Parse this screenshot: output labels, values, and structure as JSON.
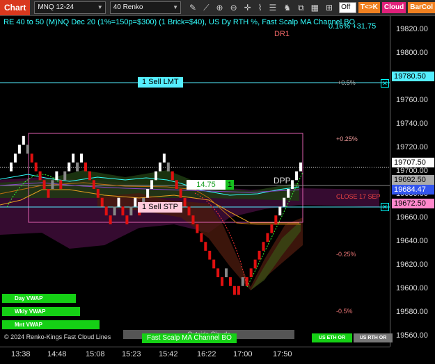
{
  "toolbar": {
    "chart_label": "Chart",
    "instrument": "MNQ 12-24",
    "bar_type": "40 Renko",
    "icons": [
      "pencil-icon",
      "draw-line-icon",
      "zoom-in-icon",
      "zoom-out-icon",
      "crosshair-icon",
      "indicators-icon",
      "list-icon",
      "strategy-icon",
      "copy-icon",
      "calendar-icon",
      "grid-icon"
    ],
    "off_value": "Off",
    "tk_label": "T<>K",
    "cloud_label": "Cloud",
    "barcol_label": "BarCol",
    "colors": {
      "chart_tab": "#d9381e",
      "tk": "#f08020",
      "cloud": "#e0207a",
      "barcol": "#f08020"
    }
  },
  "chart_data": {
    "type": "renko",
    "title": "RE 40 to 50 (M)NQ Dec 20 (1%=150p=$300) (1 Brick=$40), US Dy RTH %, Fast Scalp MA Channel BO",
    "title_suffix": "0.16% +31.75",
    "y_ticks": [
      19820,
      19800,
      19780,
      19760,
      19740,
      19720,
      19700,
      19680,
      19660,
      19640,
      19620,
      19600,
      19580,
      19560
    ],
    "y_tick_labels": [
      "19820.00",
      "19800.00",
      "19780.00",
      "19760.00",
      "19740.00",
      "19720.00",
      "19700.00",
      "19680.00",
      "19660.00",
      "19640.00",
      "19620.00",
      "19600.00",
      "19580.00",
      "19560.00"
    ],
    "ylim": [
      19551,
      19832
    ],
    "x_ticks": [
      "13:38",
      "14:48",
      "15:08",
      "15:23",
      "15:42",
      "16:22",
      "17:00",
      "17:50"
    ],
    "price_labels": [
      {
        "value": 19780.5,
        "text": "19780.50",
        "color": "#5ef"
      },
      {
        "value": 19707.5,
        "text": "19707.50",
        "color": "#ffffff"
      },
      {
        "value": 19692.5,
        "text": "19692.50",
        "color": "#aaa"
      },
      {
        "value": 19684.47,
        "text": "19684.47",
        "color": "#35e"
      },
      {
        "value": 19672.5,
        "text": "19672.50",
        "color": "#f8c"
      }
    ],
    "pct_levels": [
      {
        "text": "+0.5%",
        "value": 19780.5,
        "color": "#aaa"
      },
      {
        "text": "+0.25%",
        "value": 19731,
        "color": "#e99"
      },
      {
        "text": "-0.25%",
        "value": 19632,
        "color": "#e77"
      },
      {
        "text": "-0.5%",
        "value": 19583,
        "color": "#e77"
      }
    ],
    "dr1_label": "DR1",
    "dpp_label": "DPP",
    "close_label": "CLOSE 17 SEP",
    "bricks": [
      {
        "c": "w",
        "lo": 19700,
        "hi": 19707.5
      },
      {
        "c": "w",
        "lo": 19707.5,
        "hi": 19715
      },
      {
        "c": "w",
        "lo": 19715,
        "hi": 19722.5
      },
      {
        "c": "w",
        "lo": 19722.5,
        "hi": 19730
      },
      {
        "c": "g",
        "lo": 19715,
        "hi": 19722.5
      },
      {
        "c": "r",
        "lo": 19707.5,
        "hi": 19715
      },
      {
        "c": "r",
        "lo": 19700,
        "hi": 19707.5
      },
      {
        "c": "r",
        "lo": 19692.5,
        "hi": 19700
      },
      {
        "c": "r",
        "lo": 19685,
        "hi": 19692.5
      },
      {
        "c": "r",
        "lo": 19677.5,
        "hi": 19685
      },
      {
        "c": "g",
        "lo": 19685,
        "hi": 19692.5
      },
      {
        "c": "w",
        "lo": 19692.5,
        "hi": 19700
      },
      {
        "c": "r",
        "lo": 19685,
        "hi": 19692.5
      },
      {
        "c": "g",
        "lo": 19692.5,
        "hi": 19700
      },
      {
        "c": "w",
        "lo": 19700,
        "hi": 19707.5
      },
      {
        "c": "w",
        "lo": 19707.5,
        "hi": 19715
      },
      {
        "c": "g",
        "lo": 19700,
        "hi": 19707.5
      },
      {
        "c": "w",
        "lo": 19707.5,
        "hi": 19715
      },
      {
        "c": "r",
        "lo": 19700,
        "hi": 19707.5
      },
      {
        "c": "r",
        "lo": 19692.5,
        "hi": 19700
      },
      {
        "c": "r",
        "lo": 19685,
        "hi": 19692.5
      },
      {
        "c": "r",
        "lo": 19677.5,
        "hi": 19685
      },
      {
        "c": "r",
        "lo": 19670,
        "hi": 19677.5
      },
      {
        "c": "r",
        "lo": 19662.5,
        "hi": 19670
      },
      {
        "c": "r",
        "lo": 19655,
        "hi": 19662.5
      },
      {
        "c": "g",
        "lo": 19662.5,
        "hi": 19670
      },
      {
        "c": "w",
        "lo": 19670,
        "hi": 19677.5
      },
      {
        "c": "r",
        "lo": 19662.5,
        "hi": 19670
      },
      {
        "c": "r",
        "lo": 19655,
        "hi": 19662.5
      },
      {
        "c": "g",
        "lo": 19662.5,
        "hi": 19670
      },
      {
        "c": "w",
        "lo": 19670,
        "hi": 19677.5
      },
      {
        "c": "r",
        "lo": 19662.5,
        "hi": 19670
      },
      {
        "c": "g",
        "lo": 19670,
        "hi": 19677.5
      },
      {
        "c": "w",
        "lo": 19677.5,
        "hi": 19685
      },
      {
        "c": "w",
        "lo": 19685,
        "hi": 19692.5
      },
      {
        "c": "w",
        "lo": 19692.5,
        "hi": 19700
      },
      {
        "c": "w",
        "lo": 19700,
        "hi": 19707.5
      },
      {
        "c": "w",
        "lo": 19707.5,
        "hi": 19715
      },
      {
        "c": "g",
        "lo": 19700,
        "hi": 19707.5
      },
      {
        "c": "r",
        "lo": 19692.5,
        "hi": 19700
      },
      {
        "c": "r",
        "lo": 19685,
        "hi": 19692.5
      },
      {
        "c": "r",
        "lo": 19677.5,
        "hi": 19685
      },
      {
        "c": "r",
        "lo": 19670,
        "hi": 19677.5
      },
      {
        "c": "r",
        "lo": 19662.5,
        "hi": 19670
      },
      {
        "c": "r",
        "lo": 19655,
        "hi": 19662.5
      },
      {
        "c": "r",
        "lo": 19647.5,
        "hi": 19655
      },
      {
        "c": "r",
        "lo": 19640,
        "hi": 19647.5
      },
      {
        "c": "r",
        "lo": 19632.5,
        "hi": 19640
      },
      {
        "c": "r",
        "lo": 19625,
        "hi": 19632.5
      },
      {
        "c": "r",
        "lo": 19617.5,
        "hi": 19625
      },
      {
        "c": "r",
        "lo": 19610,
        "hi": 19617.5
      },
      {
        "c": "r",
        "lo": 19602.5,
        "hi": 19610
      },
      {
        "c": "g",
        "lo": 19610,
        "hi": 19617.5
      },
      {
        "c": "r",
        "lo": 19602.5,
        "hi": 19610
      },
      {
        "c": "r",
        "lo": 19595,
        "hi": 19602.5
      },
      {
        "c": "r",
        "lo": 19595,
        "hi": 19602.5
      },
      {
        "c": "g",
        "lo": 19602.5,
        "hi": 19610
      },
      {
        "c": "r",
        "lo": 19602.5,
        "hi": 19610
      },
      {
        "c": "r",
        "lo": 19610,
        "hi": 19617.5
      },
      {
        "c": "r",
        "lo": 19617.5,
        "hi": 19625
      },
      {
        "c": "r",
        "lo": 19625,
        "hi": 19632.5
      },
      {
        "c": "r",
        "lo": 19632.5,
        "hi": 19640
      },
      {
        "c": "r",
        "lo": 19640,
        "hi": 19647.5
      },
      {
        "c": "r",
        "lo": 19647.5,
        "hi": 19655
      },
      {
        "c": "r",
        "lo": 19655,
        "hi": 19662.5
      },
      {
        "c": "w",
        "lo": 19662.5,
        "hi": 19670
      },
      {
        "c": "w",
        "lo": 19670,
        "hi": 19677.5
      },
      {
        "c": "w",
        "lo": 19677.5,
        "hi": 19685
      },
      {
        "c": "w",
        "lo": 19685,
        "hi": 19692.5
      },
      {
        "c": "w",
        "lo": 19692.5,
        "hi": 19700
      },
      {
        "c": "w",
        "lo": 19700,
        "hi": 19707.5
      }
    ],
    "orders": [
      {
        "label": "1 Sell LMT",
        "value": 19780.5
      },
      {
        "label": "1 Sell STP",
        "value": 19672.5
      }
    ],
    "position_label": {
      "value": "14.75",
      "qty": "1"
    },
    "vwap_buttons": [
      "Day VWAP",
      "Wkly VWAP",
      "Mnt VWAP"
    ],
    "bottom_tags": {
      "outside_clouds": "Outside Clouds",
      "strategy": "Fast Scalp MA Channel BO",
      "us_eth": "US ETH OR",
      "us_rth": "US RTH OR"
    },
    "copyright": "© 2024 Renko-Kings Fast Cloud Lines"
  }
}
